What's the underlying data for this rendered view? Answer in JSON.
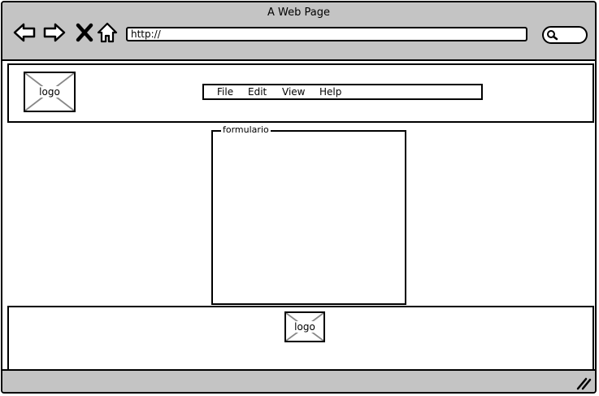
{
  "window": {
    "title": "A Web Page"
  },
  "toolbar": {
    "icons": [
      "back-arrow-icon",
      "forward-arrow-icon",
      "close-x-icon",
      "home-icon",
      "search-icon"
    ],
    "url": "http://"
  },
  "header": {
    "logo_label": "logo",
    "menu": [
      "File",
      "Edit",
      "View",
      "Help"
    ]
  },
  "main": {
    "form_legend": "formulario"
  },
  "footer": {
    "logo_label": "logo"
  },
  "colors": {
    "chrome": "#c4c4c4",
    "border": "#000000",
    "background": "#ffffff"
  }
}
